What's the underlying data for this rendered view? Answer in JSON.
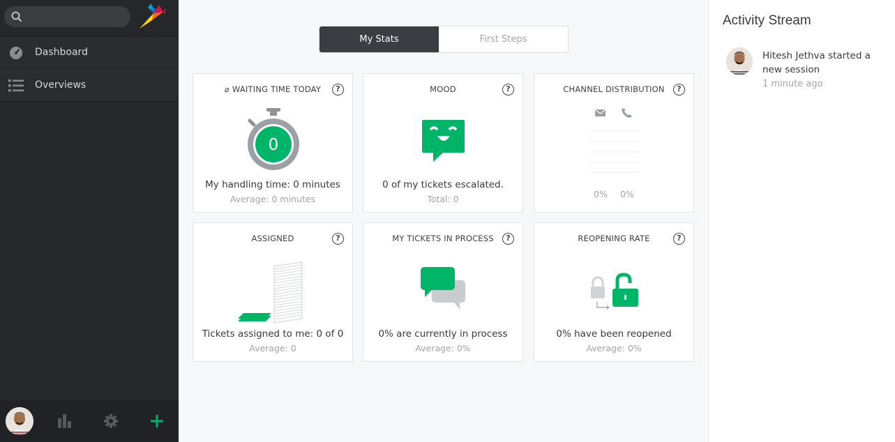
{
  "search": {
    "placeholder": ""
  },
  "nav": {
    "items": [
      {
        "label": "Dashboard",
        "icon": "dashboard-icon"
      },
      {
        "label": "Overviews",
        "icon": "list-icon"
      }
    ]
  },
  "tabs": [
    {
      "label": "My Stats",
      "active": true
    },
    {
      "label": "First Steps",
      "active": false
    }
  ],
  "cards": {
    "waiting": {
      "title": "⌀ WAITING TIME TODAY",
      "value": "0",
      "main": "My handling time: 0 minutes",
      "sub": "Average: 0 minutes"
    },
    "mood": {
      "title": "MOOD",
      "main": "0 of my tickets escalated.",
      "sub": "Total: 0"
    },
    "channel": {
      "title": "CHANNEL DISTRIBUTION",
      "email_pct": "0%",
      "phone_pct": "0%"
    },
    "assigned": {
      "title": "ASSIGNED",
      "main": "Tickets assigned to me: 0 of 0",
      "sub": "Average: 0"
    },
    "inprocess": {
      "title": "MY TICKETS IN PROCESS",
      "main": "0% are currently in process",
      "sub": "Average: 0%"
    },
    "reopening": {
      "title": "REOPENING RATE",
      "main": "0% have been reopened",
      "sub": "Average: 0%"
    }
  },
  "help_label": "?",
  "activity": {
    "title": "Activity Stream",
    "items": [
      {
        "text": "Hitesh Jethva started a new session",
        "time": "1 minute ago"
      }
    ]
  },
  "colors": {
    "accent": "#00b567",
    "sidebar": "#25272a",
    "tab_active": "#3a3d42"
  }
}
